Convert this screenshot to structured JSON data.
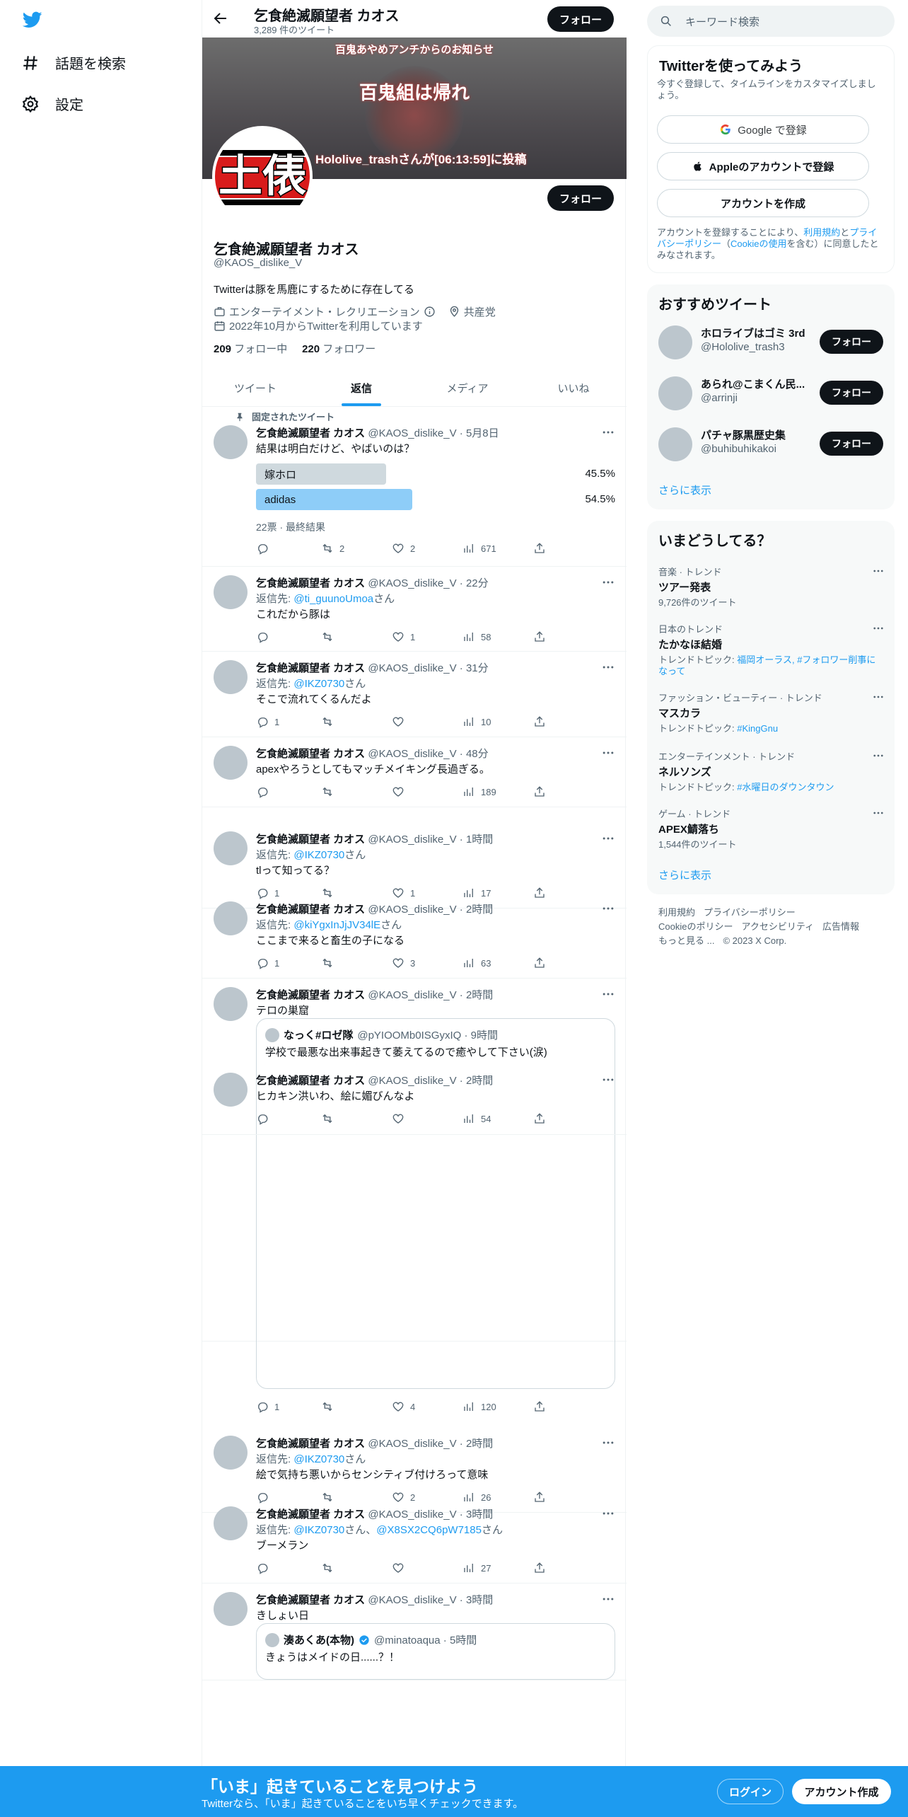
{
  "nav": {
    "explore": "話題を検索",
    "settings": "設定"
  },
  "header": {
    "name": "乞食絶滅願望者 カオス",
    "tweet_count": "3,289 件のツイート",
    "follow": "フォロー"
  },
  "banner": {
    "line1": "百鬼あやめアンチからのお知らせ",
    "line2": "百鬼組は帰れ",
    "line3": "Hololive_trashさんが[06:13:59]に投稿"
  },
  "profile": {
    "avatar_text": "土俵",
    "name": "乞食絶滅願望者 カオス",
    "handle": "@KAOS_dislike_V",
    "bio": "Twitterは豚を馬鹿にするために存在してる",
    "category": "エンターテイメント・レクリエーション",
    "location": "共産党",
    "joined": "2022年10月からTwitterを利用しています",
    "following_count": "209",
    "following_label": "フォロー中",
    "followers_count": "220",
    "followers_label": "フォロワー",
    "follow": "フォロー"
  },
  "tabs": [
    "ツイート",
    "返信",
    "メディア",
    "いいね"
  ],
  "pinned": {
    "label": "固定されたツイート",
    "name": "乞食絶滅願望者 カオス",
    "meta": "@KAOS_dislike_V · 5月8日",
    "text": "結果は明白だけど、やばいのは？",
    "poll": [
      {
        "label": "嫁ホロ",
        "pct": "45.5%",
        "value": 45.5
      },
      {
        "label": "adidas",
        "pct": "54.5%",
        "value": 54.5
      }
    ],
    "poll_footer": "22票 · 最終結果",
    "retweets": "2",
    "likes": "2",
    "views": "671"
  },
  "tweets": [
    {
      "name": "乞食絶滅願望者 カオス",
      "meta": "@KAOS_dislike_V · 22分",
      "reply_prefix": "返信先: ",
      "reply_to": "@ti_guunoUmoa",
      "reply_suffix": "さん",
      "text": "これだから豚は",
      "replies": "",
      "retweets": "",
      "likes": "1",
      "views": "58"
    },
    {
      "name": "乞食絶滅願望者 カオス",
      "meta": "@KAOS_dislike_V · 31分",
      "reply_prefix": "返信先: ",
      "reply_to": "@IKZ0730",
      "reply_suffix": "さん",
      "text": "そこで流れてくるんだよ",
      "replies": "1",
      "retweets": "",
      "likes": "",
      "views": "10"
    },
    {
      "name": "乞食絶滅願望者 カオス",
      "meta": "@KAOS_dislike_V · 48分",
      "text": "apexやろうとしてもマッチメイキング長過ぎる。",
      "replies": "",
      "retweets": "",
      "likes": "",
      "views": "189"
    },
    {
      "name": "乞食絶滅願望者 カオス",
      "meta": "@KAOS_dislike_V · 1時間",
      "reply_prefix": "返信先: ",
      "reply_to": "@IKZ0730",
      "reply_suffix": "さん",
      "text": "tlって知ってる？",
      "replies": "1",
      "retweets": "",
      "likes": "1",
      "views": "17"
    },
    {
      "name": "乞食絶滅願望者 カオス",
      "meta": "@KAOS_dislike_V · 2時間",
      "reply_prefix": "返信先: ",
      "reply_to": "@kiYgxInJjJV34lE",
      "reply_suffix": "さん",
      "text": "ここまで来ると畜生の子になる",
      "replies": "1",
      "retweets": "",
      "likes": "3",
      "views": "63"
    },
    {
      "name": "乞食絶滅願望者 カオス",
      "meta": "@KAOS_dislike_V · 2時間",
      "text": "テロの巣窟",
      "replies": "1",
      "retweets": "",
      "likes": "4",
      "views": "120",
      "quote": {
        "name": "なっく#ロゼ隊",
        "meta": "@pYIOOMb0ISGyxIQ · 9時間",
        "text": "学校で最悪な出来事起きて萎えてるので癒やして下さい(涙)"
      }
    },
    {
      "name": "乞食絶滅願望者 カオス",
      "meta": "@KAOS_dislike_V · 2時間",
      "text": "ヒカキン洪いわ、絵に媚びんなよ",
      "replies": "",
      "retweets": "",
      "likes": "",
      "views": "54"
    },
    {
      "name": "乞食絶滅願望者 カオス",
      "meta": "@KAOS_dislike_V · 2時間",
      "reply_prefix": "返信先: ",
      "reply_to": "@IKZ0730",
      "reply_suffix": "さん",
      "text": "絵で気持ち悪いからセンシティブ付けろって意味",
      "replies": "",
      "retweets": "",
      "likes": "2",
      "views": "26"
    },
    {
      "name": "乞食絶滅願望者 カオス",
      "meta": "@KAOS_dislike_V · 3時間",
      "reply_prefix": "返信先: ",
      "reply_to": "@IKZ0730",
      "reply_mid": "さん、",
      "reply_to2": "@X8SX2CQ6pW7185",
      "reply_suffix": "さん",
      "text": "ブーメラン",
      "replies": "",
      "retweets": "",
      "likes": "",
      "views": "27"
    },
    {
      "name": "乞食絶滅願望者 カオス",
      "meta": "@KAOS_dislike_V · 3時間",
      "text": "きしょい日",
      "quote": {
        "name": "湊あくあ(本物)",
        "meta": "@minatoaqua · 5時間",
        "text": "きょうはメイドの日......？！"
      }
    }
  ],
  "search": {
    "placeholder": "キーワード検索"
  },
  "signup": {
    "title": "Twitterを使ってみよう",
    "subtitle": "今すぐ登録して、タイムラインをカスタマイズしましょう。",
    "google": "Google で登録",
    "apple": "Appleのアカウントで登録",
    "create": "アカウントを作成",
    "legal_1": "アカウントを登録することにより、",
    "legal_terms": "利用規約",
    "legal_2": "と",
    "legal_privacy": "プライバシーポリシー",
    "legal_3": "（",
    "legal_cookie": "Cookieの使用",
    "legal_4": "を含む）に同意したとみなされます。"
  },
  "recommended": {
    "title": "おすすめツイート",
    "items": [
      {
        "name": "ホロライブはゴミ 3rd",
        "handle": "@Hololive_trash3"
      },
      {
        "name": "あられ@こまくん民...",
        "handle": "@arrinji"
      },
      {
        "name": "パチャ豚黒歴史集",
        "handle": "@buhibuhikakoi"
      }
    ],
    "follow": "フォロー",
    "show_more": "さらに表示"
  },
  "trends": {
    "title": "いまどうしてる？",
    "items": [
      {
        "context": "音楽 · トレンド",
        "topic": "ツアー発表",
        "sub": "9,726件のツイート"
      },
      {
        "context": "日本のトレンド",
        "topic": "たかなほ結婚",
        "sub_prefix": "トレンドトピック: ",
        "sub_link": "福岡オーラス, #フォロワー削事になって"
      },
      {
        "context": "ファッション・ビューティー · トレンド",
        "topic": "マスカラ",
        "sub_prefix": "トレンドトピック: ",
        "sub_link": "#KingGnu"
      },
      {
        "context": "エンターテインメント · トレンド",
        "topic": "ネルソンズ",
        "sub_prefix": "トレンドトピック: ",
        "sub_link": "#水曜日のダウンタウン"
      },
      {
        "context": "ゲーム · トレンド",
        "topic": "APEX鯖落ち",
        "sub": "1,544件のツイート"
      }
    ],
    "show_more": "さらに表示"
  },
  "footer": {
    "terms": "利用規約",
    "privacy": "プライバシーポリシー",
    "cookie": "Cookieのポリシー",
    "accessibility": "アクセシビリティ",
    "ads": "広告情報",
    "more": "もっと見る ...",
    "copyright": "© 2023 X Corp."
  },
  "bottom": {
    "title": "「いま」起きていることを見つけよう",
    "subtitle": "Twitterなら、「いま」起きていることをいち早くチェックできます。",
    "login": "ログイン",
    "signup": "アカウント作成"
  },
  "colors": {
    "accent": "#1d9bf0",
    "dark": "#0f1419",
    "secondary": "#536471",
    "poll_winner": "#8ecdf8",
    "poll_loser": "#cfd9de"
  }
}
